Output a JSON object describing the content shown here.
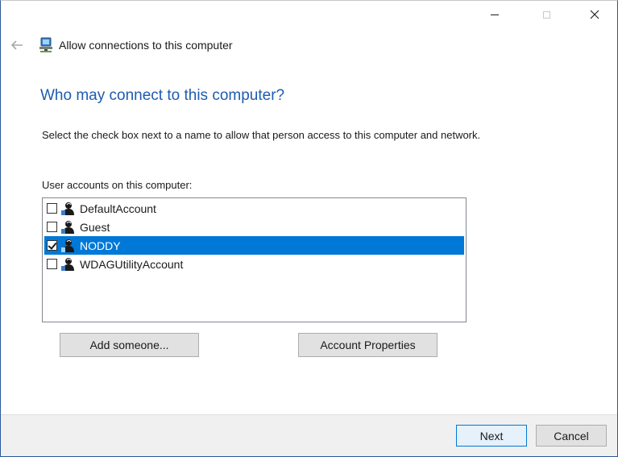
{
  "window": {
    "title": "Allow connections to this computer",
    "controls": {
      "minimize": "minimize-icon",
      "maximize": "maximize-icon",
      "close": "close-icon"
    }
  },
  "header": {
    "back_icon": "back-arrow-icon",
    "app_icon": "network-computer-icon"
  },
  "main": {
    "heading": "Who may connect to this computer?",
    "instruction": "Select the check box next to a name to allow that person access to this computer and network.",
    "list_label": "User accounts on this computer:",
    "accounts": [
      {
        "name": "DefaultAccount",
        "checked": false,
        "selected": false
      },
      {
        "name": "Guest",
        "checked": false,
        "selected": false
      },
      {
        "name": "NODDY",
        "checked": true,
        "selected": true
      },
      {
        "name": "WDAGUtilityAccount",
        "checked": false,
        "selected": false
      }
    ],
    "add_label": "Add someone...",
    "properties_label": "Account Properties"
  },
  "footer": {
    "next_label": "Next",
    "cancel_label": "Cancel"
  },
  "colors": {
    "heading": "#1e5bb0",
    "selection": "#0078d7",
    "footer_bg": "#f0f0f0"
  }
}
